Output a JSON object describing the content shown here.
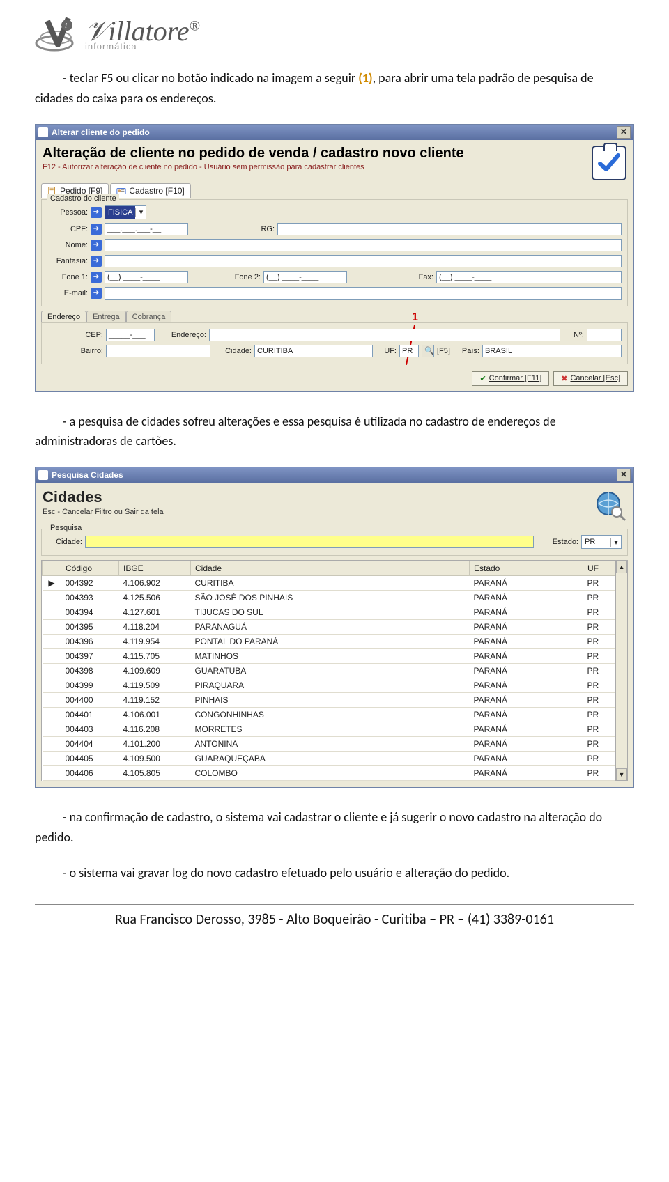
{
  "logo": {
    "name": "illatore",
    "sub": "informática"
  },
  "para1_a": "- teclar F5 ou clicar no botão indicado na imagem a seguir ",
  "para1_callout": "(1)",
  "para1_b": ", para abrir uma tela padrão de pesquisa de cidades do caixa para os endereços.",
  "win1": {
    "title": "Alterar cliente do pedido",
    "heading": "Alteração de cliente no pedido de venda / cadastro novo cliente",
    "sub": "F12 - Autorizar alteração de cliente no pedido  - Usuário sem permissão para cadastrar clientes",
    "tab_pedido": "Pedido [F9]",
    "tab_cadastro": "Cadastro [F10]",
    "group_legend": "Cadastro do cliente",
    "l_pessoa": "Pessoa:",
    "pessoa_val": "FISICA",
    "l_cpf": "CPF:",
    "cpf_val": "___.___.___-__",
    "l_rg": "RG:",
    "l_nome": "Nome:",
    "l_fantasia": "Fantasia:",
    "l_fone1": "Fone 1:",
    "fone_val": "(__) ____-____",
    "l_fone2": "Fone 2:",
    "l_fax": "Fax:",
    "l_email": "E-mail:",
    "subtab_end": "Endereço",
    "subtab_ent": "Entrega",
    "subtab_cob": "Cobrança",
    "l_cep": "CEP:",
    "cep_val": "_____-___",
    "l_endereco": "Endereço:",
    "l_numero": "Nº:",
    "l_bairro": "Bairro:",
    "l_cidade": "Cidade:",
    "cidade_val": "CURITIBA",
    "l_uf": "UF:",
    "uf_val": "PR",
    "f5": "[F5]",
    "l_pais": "País:",
    "pais_val": "BRASIL",
    "annot": "1",
    "btn_confirm": "Confirmar [F11]",
    "btn_cancel": "Cancelar [Esc]"
  },
  "para2": "- a pesquisa de cidades sofreu alterações e essa pesquisa é utilizada no cadastro de endereços de administradoras de cartões.",
  "win2": {
    "title": "Pesquisa Cidades",
    "heading": "Cidades",
    "sub": "Esc - Cancelar Filtro ou Sair da tela",
    "grp": "Pesquisa",
    "l_cidade": "Cidade:",
    "l_estado": "Estado:",
    "estado_val": "PR",
    "cols": {
      "codigo": "Código",
      "ibge": "IBGE",
      "cidade": "Cidade",
      "estado": "Estado",
      "uf": "UF"
    },
    "rows": [
      {
        "codigo": "004392",
        "ibge": "4.106.902",
        "cidade": "CURITIBA",
        "estado": "PARANÁ",
        "uf": "PR"
      },
      {
        "codigo": "004393",
        "ibge": "4.125.506",
        "cidade": "SÃO JOSÉ DOS PINHAIS",
        "estado": "PARANÁ",
        "uf": "PR"
      },
      {
        "codigo": "004394",
        "ibge": "4.127.601",
        "cidade": "TIJUCAS DO SUL",
        "estado": "PARANÁ",
        "uf": "PR"
      },
      {
        "codigo": "004395",
        "ibge": "4.118.204",
        "cidade": "PARANAGUÁ",
        "estado": "PARANÁ",
        "uf": "PR"
      },
      {
        "codigo": "004396",
        "ibge": "4.119.954",
        "cidade": "PONTAL DO PARANÁ",
        "estado": "PARANÁ",
        "uf": "PR"
      },
      {
        "codigo": "004397",
        "ibge": "4.115.705",
        "cidade": "MATINHOS",
        "estado": "PARANÁ",
        "uf": "PR"
      },
      {
        "codigo": "004398",
        "ibge": "4.109.609",
        "cidade": "GUARATUBA",
        "estado": "PARANÁ",
        "uf": "PR"
      },
      {
        "codigo": "004399",
        "ibge": "4.119.509",
        "cidade": "PIRAQUARA",
        "estado": "PARANÁ",
        "uf": "PR"
      },
      {
        "codigo": "004400",
        "ibge": "4.119.152",
        "cidade": "PINHAIS",
        "estado": "PARANÁ",
        "uf": "PR"
      },
      {
        "codigo": "004401",
        "ibge": "4.106.001",
        "cidade": "CONGONHINHAS",
        "estado": "PARANÁ",
        "uf": "PR"
      },
      {
        "codigo": "004403",
        "ibge": "4.116.208",
        "cidade": "MORRETES",
        "estado": "PARANÁ",
        "uf": "PR"
      },
      {
        "codigo": "004404",
        "ibge": "4.101.200",
        "cidade": "ANTONINA",
        "estado": "PARANÁ",
        "uf": "PR"
      },
      {
        "codigo": "004405",
        "ibge": "4.109.500",
        "cidade": "GUARAQUEÇABA",
        "estado": "PARANÁ",
        "uf": "PR"
      },
      {
        "codigo": "004406",
        "ibge": "4.105.805",
        "cidade": "COLOMBO",
        "estado": "PARANÁ",
        "uf": "PR"
      }
    ]
  },
  "para3": "- na confirmação de cadastro, o sistema vai cadastrar o cliente e já sugerir o novo cadastro na alteração do pedido.",
  "para4": "- o sistema vai gravar log do novo cadastro efetuado pelo usuário e alteração do pedido.",
  "footer": "Rua Francisco Derosso, 3985  - Alto Boqueirão - Curitiba – PR  – (41) 3389-0161"
}
